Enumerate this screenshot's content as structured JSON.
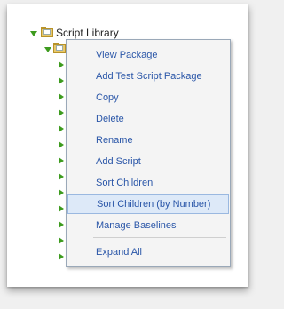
{
  "tree": {
    "root_label": "Script Library"
  },
  "context_menu": {
    "items": [
      {
        "label": "View Package"
      },
      {
        "label": "Add Test Script Package"
      },
      {
        "label": "Copy"
      },
      {
        "label": "Delete"
      },
      {
        "label": "Rename"
      },
      {
        "label": "Add Script"
      },
      {
        "label": "Sort Children"
      },
      {
        "label": "Sort Children (by Number)"
      },
      {
        "label": "Manage Baselines"
      },
      {
        "label": "Expand All"
      }
    ],
    "highlighted_item": "Sort Children (by Number)"
  },
  "colors": {
    "menu_text": "#2a56a8",
    "highlight_bg": "#dde9f8",
    "expander": "#3d9b1e",
    "folder": "#e8c86a"
  },
  "icons": [
    "expand-triangle-icon",
    "folder-icon",
    "collapsed-triangle-icon"
  ]
}
